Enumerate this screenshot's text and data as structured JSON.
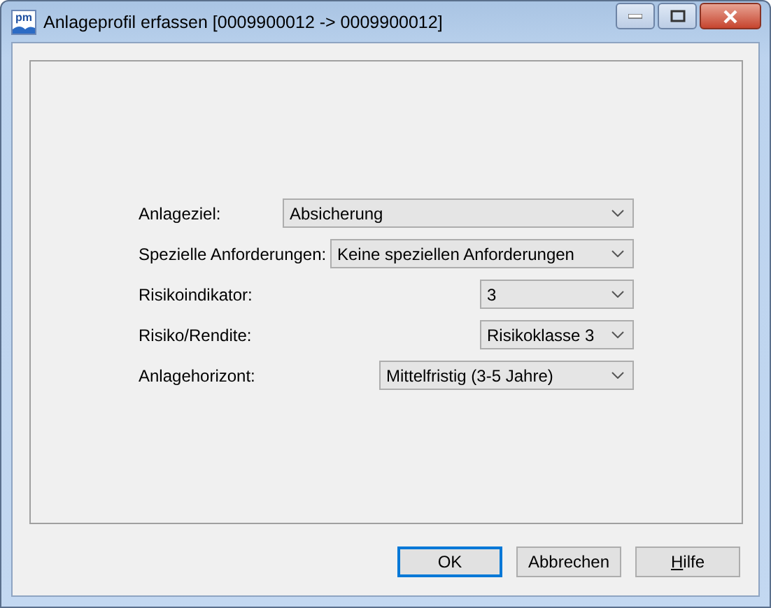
{
  "window": {
    "title": "Anlageprofil erfassen [0009900012 -> 0009900012]",
    "icon_text": "pm"
  },
  "fields": [
    {
      "label": "Anlageziel:",
      "value": "Absicherung"
    },
    {
      "label": "Spezielle Anforderungen:",
      "value": "Keine speziellen Anforderungen"
    },
    {
      "label": "Risikoindikator:",
      "value": "3"
    },
    {
      "label": "Risiko/Rendite:",
      "value": "Risikoklasse 3"
    },
    {
      "label": "Anlagehorizont:",
      "value": "Mittelfristig (3-5 Jahre)"
    }
  ],
  "buttons": [
    {
      "label": "OK",
      "default": true,
      "mnemonic": false
    },
    {
      "label": "Abbrechen",
      "default": false,
      "mnemonic": false
    },
    {
      "label": "Hilfe",
      "default": false,
      "mnemonic": true
    }
  ]
}
